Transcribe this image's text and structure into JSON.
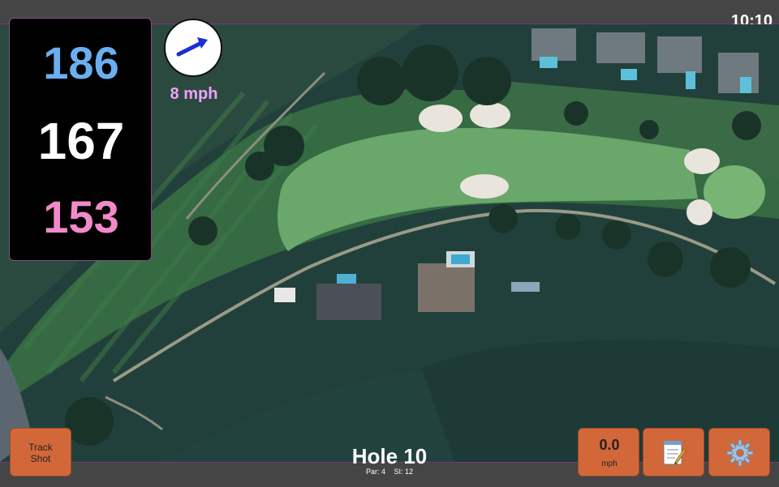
{
  "status": {
    "time": "10:10"
  },
  "distances": {
    "back": "186",
    "middle": "167",
    "front": "153"
  },
  "wind": {
    "speed": "8 mph",
    "icon": "wind-arrow-icon"
  },
  "hole": {
    "title": "Hole 10",
    "par": "Par: 4",
    "si": "SI: 12"
  },
  "buttons": {
    "track_line1": "Track",
    "track_line2": "Shot",
    "speed_value": "0.0",
    "speed_unit": "mph",
    "notes_icon": "notepad-icon",
    "settings_icon": "gear-icon"
  },
  "colors": {
    "accent": "#d2683a",
    "back_dist": "#6ab0f0",
    "front_dist": "#f08ac8",
    "wind_text": "#f0a0ff"
  }
}
